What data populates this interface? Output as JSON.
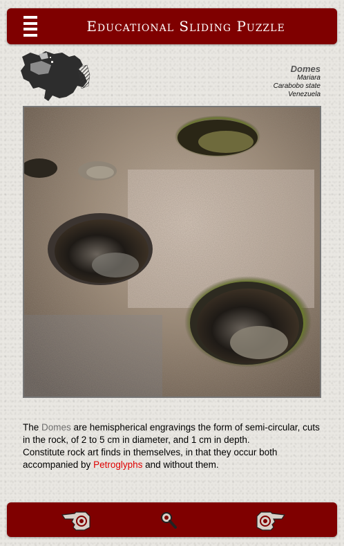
{
  "header": {
    "title": "Educational Sliding Puzzle",
    "menu_icon": "hamburger-menu-icon"
  },
  "site": {
    "name": "Domes",
    "locality": "Mariara",
    "state": "Carabobo state",
    "country": "Venezuela"
  },
  "description": {
    "p1_before": "The ",
    "p1_keyword": "Domes",
    "p1_after": " are hemispherical  engravings the form of semi-circular, cuts in the  rock, of 2 to 5 cm in diameter, and 1 cm in depth.",
    "p2_before": "Constitute rock art finds in themselves, in  that  they occur both accompanied by ",
    "p2_keyword": "Petroglyphs",
    "p2_after": " and without them."
  },
  "footer": {
    "prev_icon": "pointing-hand-left-icon",
    "zoom_icon": "magnifier-icon",
    "next_icon": "pointing-hand-right-icon"
  },
  "colors": {
    "bar": "#7f0000",
    "keyword_grey": "#6e6e6e",
    "keyword_red": "#e00000"
  }
}
